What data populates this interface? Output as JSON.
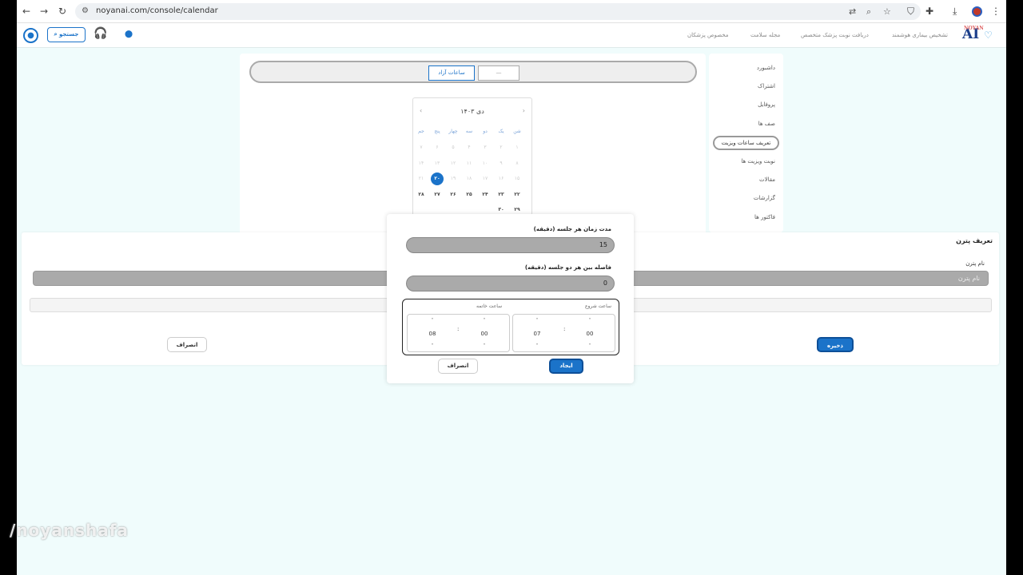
{
  "browser": {
    "url": "noyanai.com/console/calendar",
    "nav_back": "←",
    "nav_forward": "→",
    "nav_reload": "↻",
    "tune": "⚙"
  },
  "header": {
    "logo_text": "AI",
    "logo_small": "NOYAN",
    "nav_items": [
      "تشخیص بیماری هوشمند",
      "دریافت نوبت پزشک متخصص",
      "مجله سلامت",
      "مخصوص پزشکان"
    ],
    "search_label": "جستجو",
    "user_glyph": "●"
  },
  "tabs": {
    "open_hours": "ساعات آزاد",
    "busy": "—"
  },
  "calendar": {
    "title": "دی ۱۴۰۳",
    "prev": "‹",
    "next": "›",
    "weekdays": [
      "شن",
      "یک",
      "دو",
      "سه",
      "چهار",
      "پنج",
      "جم"
    ],
    "rows": [
      [
        "۱",
        "۲",
        "۳",
        "۴",
        "۵",
        "۶",
        "۷"
      ],
      [
        "۸",
        "۹",
        "۱۰",
        "۱۱",
        "۱۲",
        "۱۳",
        "۱۴"
      ],
      [
        "۱۵",
        "۱۶",
        "۱۷",
        "۱۸",
        "۱۹",
        "۲۰",
        "۲۱"
      ],
      [
        "۲۲",
        "۲۳",
        "۲۴",
        "۲۵",
        "۲۶",
        "۲۷",
        "۲۸"
      ],
      [
        "۲۹",
        "۳۰",
        "",
        "",
        "",
        "",
        ""
      ]
    ],
    "selected": "۲۰"
  },
  "sidebar": {
    "items": [
      "داشبورد",
      "اشتراک",
      "پروفایل",
      "صف ها",
      "تعریف ساعات ویزیت",
      "نوبت ویزیت ها",
      "مقالات",
      "گزارشات",
      "فاکتور ها"
    ],
    "active_index": 4
  },
  "pattern": {
    "title": "تعریف پترن",
    "name_label": "نام پترن",
    "name_placeholder": "نام پترن",
    "save": "ذخیره",
    "cancel": "انصراف"
  },
  "modal": {
    "duration_label": "مدت زمان هر جلسه (دقیقه)",
    "duration_value": "15",
    "gap_label": "فاصله بین هر دو جلسه (دقیقه)",
    "gap_value": "0",
    "start_label": "ساعت شروع",
    "end_label": "ساعت خاتمه",
    "start_hour": "07",
    "start_minute": "00",
    "end_hour": "08",
    "end_minute": "00",
    "separator": ":",
    "up": "˄",
    "down": "˅",
    "create": "ایجاد",
    "cancel": "انصراف"
  },
  "watermark": "/noyanshafa"
}
